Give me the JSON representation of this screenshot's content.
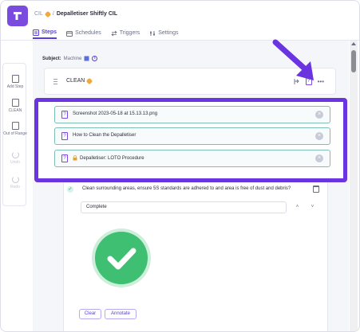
{
  "breadcrumb": {
    "parent": "CIL",
    "separator": "/",
    "current": "Depalletiser Shiftly CIL"
  },
  "tabs": [
    {
      "label": "Steps",
      "icon": "list-icon"
    },
    {
      "label": "Schedules",
      "icon": "calendar-icon"
    },
    {
      "label": "Triggers",
      "icon": "swap-icon"
    },
    {
      "label": "Settings",
      "icon": "sliders-icon"
    }
  ],
  "rail": {
    "items": [
      {
        "label": "Add Step",
        "icon": "add-step-icon"
      },
      {
        "label": "CLEAN",
        "icon": "clean-icon"
      },
      {
        "label": "Out of Range",
        "icon": "out-of-range-icon"
      },
      {
        "label": "Undo",
        "icon": "undo-icon"
      },
      {
        "label": "Redo",
        "icon": "redo-icon"
      }
    ]
  },
  "subject": {
    "label": "Subject:",
    "value": "Machine"
  },
  "step": {
    "title": "CLEAN",
    "more": "•••"
  },
  "references": [
    {
      "text": "Screenshot 2023-05-18 at 15.13.13.png"
    },
    {
      "text": "How to Clean the Depalletiser"
    },
    {
      "text": "Depalletiser: LOTO Procedure"
    }
  ],
  "check": {
    "question": "Clean surrounding areas, ensure 5S standards are adhered to and area is free of dust and debris?",
    "selected": "Complete",
    "clear_label": "Clear",
    "annotate_label": "Annotate"
  },
  "colors": {
    "accent": "#5b3fd8",
    "highlight": "#6a35e0",
    "success": "#3fbf72"
  }
}
